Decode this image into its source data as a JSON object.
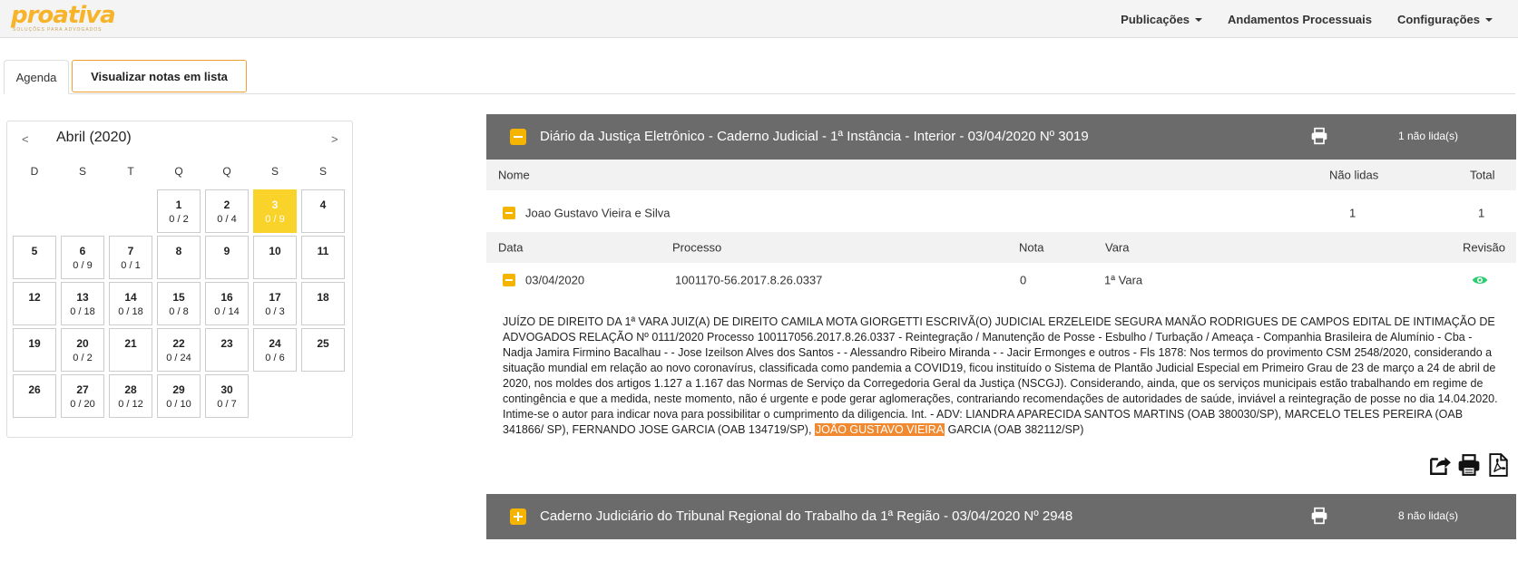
{
  "brand": {
    "logo_text": "proativa",
    "logo_tagline": "SOLUÇÕES PARA ADVOGADOS"
  },
  "nav": {
    "publicacoes": "Publicações",
    "andamentos": "Andamentos Processuais",
    "configuracoes": "Configurações"
  },
  "tabs": {
    "agenda": "Agenda",
    "lista": "Visualizar notas em lista"
  },
  "calendar": {
    "title": "Abril (2020)",
    "prev": "<",
    "next": ">",
    "weekdays": [
      "D",
      "S",
      "T",
      "Q",
      "Q",
      "S",
      "S"
    ],
    "days": [
      {
        "day": "1",
        "count": "0 / 2"
      },
      {
        "day": "2",
        "count": "0 / 4"
      },
      {
        "day": "3",
        "count": "0 / 9",
        "selected": true
      },
      {
        "day": "4",
        "count": ""
      },
      {
        "day": "5",
        "count": ""
      },
      {
        "day": "6",
        "count": "0 / 9"
      },
      {
        "day": "7",
        "count": "0 / 1"
      },
      {
        "day": "8",
        "count": ""
      },
      {
        "day": "9",
        "count": ""
      },
      {
        "day": "10",
        "count": ""
      },
      {
        "day": "11",
        "count": ""
      },
      {
        "day": "12",
        "count": ""
      },
      {
        "day": "13",
        "count": "0 / 18"
      },
      {
        "day": "14",
        "count": "0 / 18"
      },
      {
        "day": "15",
        "count": "0 / 8"
      },
      {
        "day": "16",
        "count": "0 / 14"
      },
      {
        "day": "17",
        "count": "0 / 3"
      },
      {
        "day": "18",
        "count": ""
      },
      {
        "day": "19",
        "count": ""
      },
      {
        "day": "20",
        "count": "0 / 2"
      },
      {
        "day": "21",
        "count": ""
      },
      {
        "day": "22",
        "count": "0 / 24"
      },
      {
        "day": "23",
        "count": ""
      },
      {
        "day": "24",
        "count": "0 / 6"
      },
      {
        "day": "25",
        "count": ""
      },
      {
        "day": "26",
        "count": ""
      },
      {
        "day": "27",
        "count": "0 / 20"
      },
      {
        "day": "28",
        "count": "0 / 12"
      },
      {
        "day": "29",
        "count": "0 / 10"
      },
      {
        "day": "30",
        "count": "0 / 7"
      }
    ]
  },
  "publication1": {
    "title": "Diário da Justiça Eletrônico - Caderno Judicial - 1ª Instância - Interior - 03/04/2020 Nº 3019",
    "unread": "1 não lida(s)",
    "cols": {
      "nome": "Nome",
      "nao_lidas": "Não lidas",
      "total": "Total"
    },
    "person": {
      "name": "Joao Gustavo Vieira e Silva",
      "nao_lidas": "1",
      "total": "1"
    },
    "subcols": {
      "data": "Data",
      "processo": "Processo",
      "nota": "Nota",
      "vara": "Vara",
      "revisao": "Revisão"
    },
    "entry": {
      "data": "03/04/2020",
      "processo": "1001170-56.2017.8.26.0337",
      "nota": "0",
      "vara": "1ª Vara"
    },
    "text_before": "JUÍZO DE DIREITO DA 1ª VARA JUIZ(A) DE DIREITO CAMILA MOTA GIORGETTI ESCRIVÃ(O) JUDICIAL ERZELEIDE SEGURA MANÃO RODRIGUES DE CAMPOS EDITAL DE INTIMAÇÃO DE ADVOGADOS RELAÇÃO Nº 0111/2020 Processo 100117056.2017.8.26.0337 - Reintegração / Manutenção de Posse - Esbulho / Turbação / Ameaça - Companhia Brasileira de Alumínio - Cba - Nadja Jamira Firmino Bacalhau - - Jose Izeilson Alves dos Santos - - Alessandro Ribeiro Miranda - - Jacir Ermonges e outros - Fls 1878: Nos termos do provimento CSM 2548/2020, considerando a situação mundial em relação ao novo coronavírus, classificada como pandemia a COVID19, ficou instituído o Sistema de Plantão Judicial Especial em Primeiro Grau de 23 de março a 24 de abril de 2020, nos moldes dos artigos 1.127 a 1.167 das Normas de Serviço da Corregedoria Geral da Justiça (NSCGJ). Considerando, ainda, que os serviços municipais estão trabalhando em regime de contingência e que a medida, neste momento, não é urgente e pode gerar aglomerações, contrariando recomendações de autoridades de saúde, inviável a reintegração de posse no dia 14.04.2020. Intime-se o autor para indicar nova para possibilitar o cumprimento da diligencia. Int. - ADV: LIANDRA APARECIDA SANTOS MARTINS (OAB 380030/SP), MARCELO TELES PEREIRA (OAB 341866/ SP), FERNANDO JOSE GARCIA (OAB 134719/SP), ",
    "text_highlight": "JOÃO GUSTAVO VIEIRA",
    "text_after": " GARCIA (OAB 382112/SP)"
  },
  "publication2": {
    "title": "Caderno Judiciário do Tribunal Regional do Trabalho da 1ª Região - 03/04/2020 Nº 2948",
    "unread": "8 não lida(s)"
  },
  "colors": {
    "accent": "#f5b400",
    "selected_day": "#f9d22a",
    "panel_header": "#6b6b6b",
    "highlight": "#f0892f",
    "eye": "#2ecc71"
  }
}
